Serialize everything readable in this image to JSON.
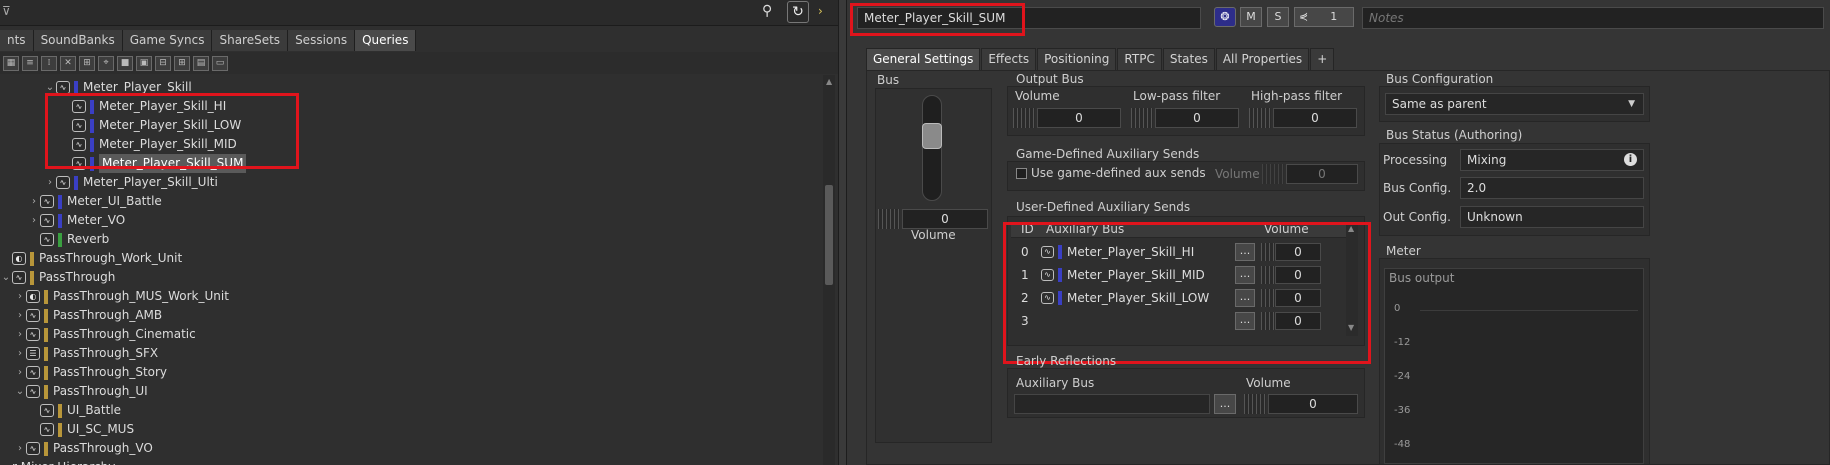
{
  "left": {
    "tabs": [
      "nts",
      "SoundBanks",
      "Game Syncs",
      "ShareSets",
      "Sessions",
      "Queries"
    ],
    "active_tab": 5,
    "tree": [
      {
        "label": "Meter_Player_Skill",
        "indent": 44,
        "chev": "v",
        "color": "#3a3fc4",
        "icon": "bus"
      },
      {
        "label": "Meter_Player_Skill_HI",
        "indent": 60,
        "chev": "",
        "color": "#3a3fc4",
        "icon": "bus"
      },
      {
        "label": "Meter_Player_Skill_LOW",
        "indent": 60,
        "chev": "",
        "color": "#3a3fc4",
        "icon": "bus"
      },
      {
        "label": "Meter_Player_Skill_MID",
        "indent": 60,
        "chev": "",
        "color": "#3a3fc4",
        "icon": "bus"
      },
      {
        "label": "Meter_Player_Skill_SUM",
        "indent": 60,
        "chev": "",
        "color": "#3a3fc4",
        "icon": "bus",
        "selected": true
      },
      {
        "label": "Meter_Player_Skill_Ulti",
        "indent": 44,
        "chev": ">",
        "color": "#3a3fc4",
        "icon": "bus"
      },
      {
        "label": "Meter_UI_Battle",
        "indent": 28,
        "chev": ">",
        "color": "#3a3fc4",
        "icon": "bus"
      },
      {
        "label": "Meter_VO",
        "indent": 28,
        "chev": ">",
        "color": "#3a3fc4",
        "icon": "bus"
      },
      {
        "label": "Reverb",
        "indent": 28,
        "chev": "",
        "color": "#3aa040",
        "icon": "bus"
      },
      {
        "label": "PassThrough_Work_Unit",
        "indent": 0,
        "chev": "",
        "color": "#b8963a",
        "icon": "wu"
      },
      {
        "label": "PassThrough",
        "indent": 0,
        "chev": "v",
        "color": "#b8963a",
        "icon": "bus"
      },
      {
        "label": "PassThrough_MUS_Work_Unit",
        "indent": 14,
        "chev": ">",
        "color": "#b8963a",
        "icon": "wu"
      },
      {
        "label": "PassThrough_AMB",
        "indent": 14,
        "chev": ">",
        "color": "#b8963a",
        "icon": "bus"
      },
      {
        "label": "PassThrough_Cinematic",
        "indent": 14,
        "chev": ">",
        "color": "#b8963a",
        "icon": "bus"
      },
      {
        "label": "PassThrough_SFX",
        "indent": 14,
        "chev": ">",
        "color": "#b8963a",
        "icon": "list"
      },
      {
        "label": "PassThrough_Story",
        "indent": 14,
        "chev": ">",
        "color": "#b8963a",
        "icon": "bus"
      },
      {
        "label": "PassThrough_UI",
        "indent": 14,
        "chev": "v",
        "color": "#b8963a",
        "icon": "bus"
      },
      {
        "label": "UI_Battle",
        "indent": 28,
        "chev": "",
        "color": "#b8963a",
        "icon": "bus"
      },
      {
        "label": "UI_SC_MUS",
        "indent": 28,
        "chev": "",
        "color": "#b8963a",
        "icon": "bus"
      },
      {
        "label": "PassThrough_VO",
        "indent": 14,
        "chev": ">",
        "color": "#b8963a",
        "icon": "bus"
      },
      {
        "label": "r Mixer Hierarchy",
        "indent": 0,
        "chev": "",
        "color": "",
        "icon": ""
      }
    ]
  },
  "right": {
    "object_name": "Meter_Player_Skill_SUM",
    "m_label": "M",
    "s_label": "S",
    "ref_count": "1",
    "notes_placeholder": "Notes",
    "tabs": [
      "General Settings",
      "Effects",
      "Positioning",
      "RTPC",
      "States",
      "All Properties",
      "+"
    ],
    "active_tab": 0,
    "bus": {
      "title": "Bus",
      "value": "0",
      "label": "Volume"
    },
    "output_bus": {
      "title": "Output Bus",
      "volume_label": "Volume",
      "volume": "0",
      "lowpass_label": "Low-pass filter",
      "lowpass": "0",
      "highpass_label": "High-pass filter",
      "highpass": "0"
    },
    "game_defined": {
      "title": "Game-Defined Auxiliary Sends",
      "checkbox_label": "Use game-defined aux sends",
      "volume_label": "Volume",
      "volume": "0"
    },
    "user_defined": {
      "title": "User-Defined Auxiliary Sends",
      "col_id": "ID",
      "col_bus": "Auxiliary Bus",
      "col_volume": "Volume",
      "rows": [
        {
          "id": "0",
          "bus": "Meter_Player_Skill_HI",
          "volume": "0"
        },
        {
          "id": "1",
          "bus": "Meter_Player_Skill_MID",
          "volume": "0"
        },
        {
          "id": "2",
          "bus": "Meter_Player_Skill_LOW",
          "volume": "0"
        },
        {
          "id": "3",
          "bus": "",
          "volume": "0"
        }
      ],
      "ellipsis": "..."
    },
    "early_reflections": {
      "title": "Early Reflections",
      "aux_label": "Auxiliary Bus",
      "volume_label": "Volume",
      "volume": "0"
    },
    "bus_config": {
      "title": "Bus Configuration",
      "value": "Same as parent"
    },
    "bus_status": {
      "title": "Bus Status (Authoring)",
      "processing_label": "Processing",
      "processing": "Mixing",
      "busconfig_label": "Bus Config.",
      "busconfig": "2.0",
      "outconfig_label": "Out Config.",
      "outconfig": "Unknown"
    },
    "meter": {
      "title": "Meter",
      "subtitle": "Bus output",
      "ticks": [
        "0",
        "-12",
        "-24",
        "-36",
        "-48"
      ]
    }
  }
}
